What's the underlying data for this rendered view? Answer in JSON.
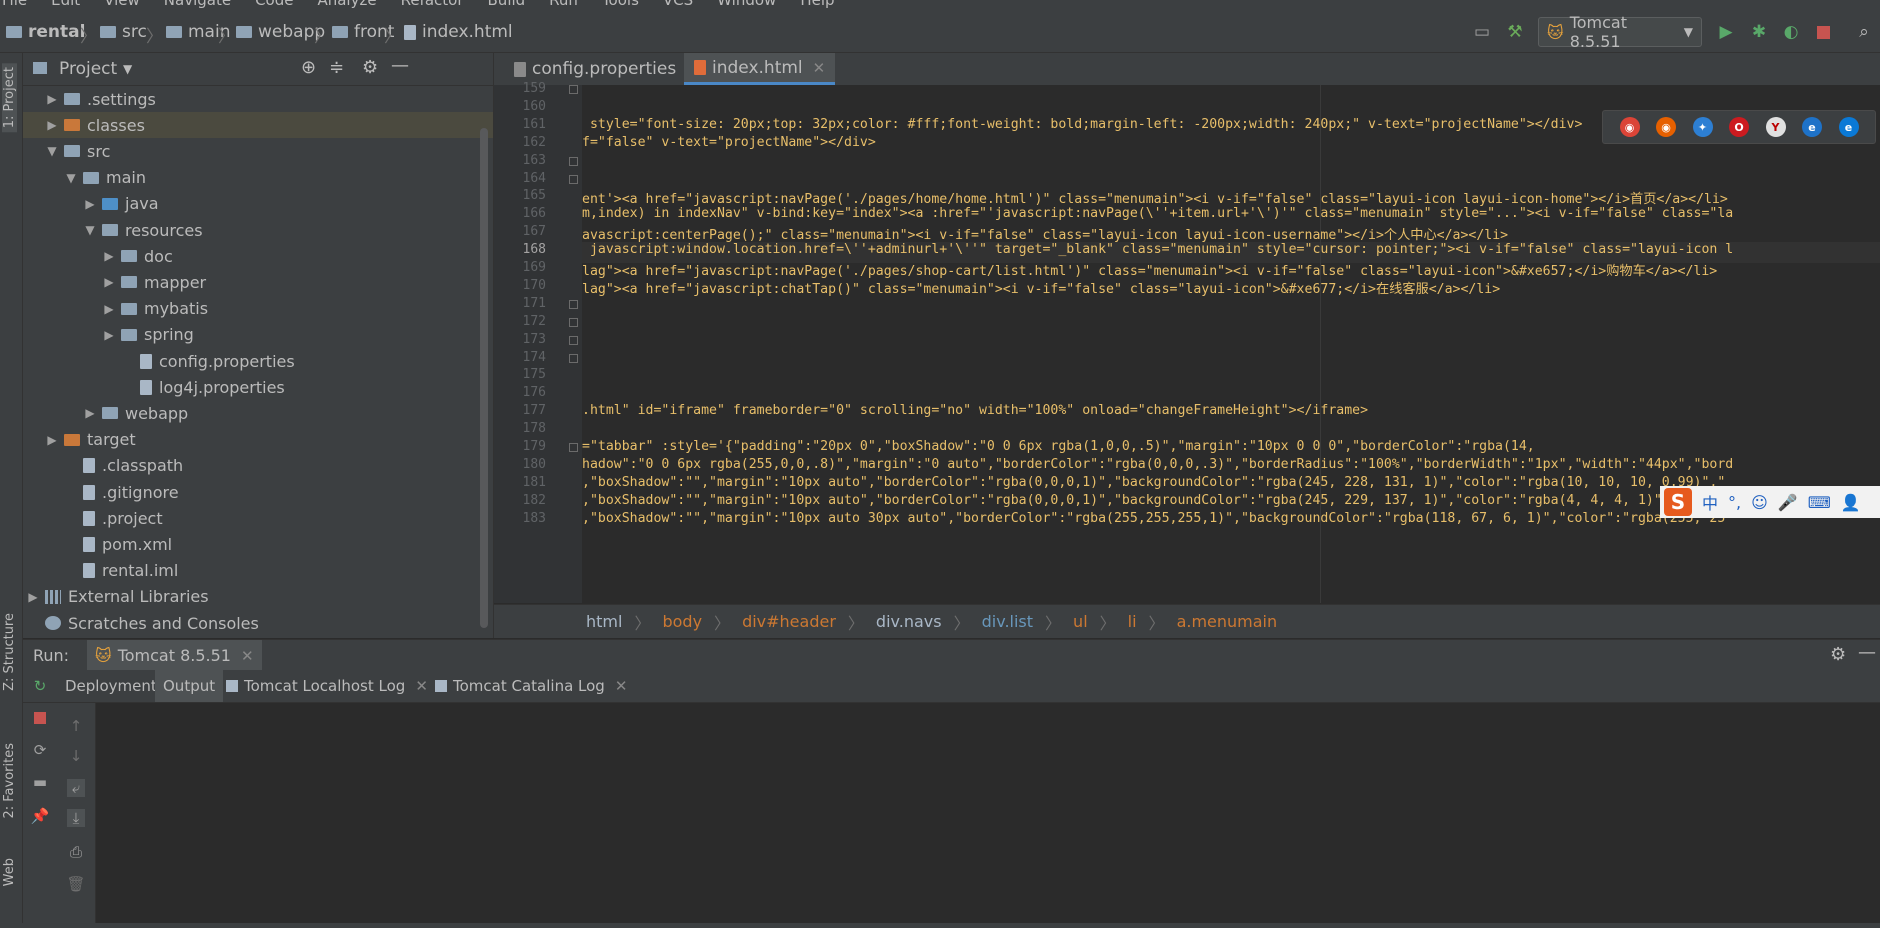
{
  "menu": [
    "File",
    "Edit",
    "View",
    "Navigate",
    "Code",
    "Analyze",
    "Refactor",
    "Build",
    "Run",
    "Tools",
    "VCS",
    "Window",
    "Help"
  ],
  "nav_path": [
    "rental",
    "src",
    "main",
    "webapp",
    "front",
    "index.html"
  ],
  "run_config": "Tomcat 8.5.51",
  "side_tabs": {
    "project": "1: Project",
    "structure": "Z: Structure",
    "favorites": "2: Favorites",
    "web": "Web"
  },
  "project_panel": {
    "title": "Project"
  },
  "tree": [
    {
      "label": ".settings",
      "depth": 1,
      "arrow": "▶",
      "icon": "folder"
    },
    {
      "label": "classes",
      "depth": 1,
      "arrow": "▶",
      "icon": "folder-or"
    },
    {
      "label": "src",
      "depth": 1,
      "arrow": "▼",
      "icon": "folder"
    },
    {
      "label": "main",
      "depth": 2,
      "arrow": "▼",
      "icon": "folder"
    },
    {
      "label": "java",
      "depth": 3,
      "arrow": "▶",
      "icon": "folder-bl"
    },
    {
      "label": "resources",
      "depth": 3,
      "arrow": "▼",
      "icon": "folder"
    },
    {
      "label": "doc",
      "depth": 4,
      "arrow": "▶",
      "icon": "folder"
    },
    {
      "label": "mapper",
      "depth": 4,
      "arrow": "▶",
      "icon": "folder"
    },
    {
      "label": "mybatis",
      "depth": 4,
      "arrow": "▶",
      "icon": "folder"
    },
    {
      "label": "spring",
      "depth": 4,
      "arrow": "▶",
      "icon": "folder"
    },
    {
      "label": "config.properties",
      "depth": 5,
      "arrow": "",
      "icon": "file"
    },
    {
      "label": "log4j.properties",
      "depth": 5,
      "arrow": "",
      "icon": "file"
    },
    {
      "label": "webapp",
      "depth": 3,
      "arrow": "▶",
      "icon": "folder"
    },
    {
      "label": "target",
      "depth": 1,
      "arrow": "▶",
      "icon": "folder-or"
    },
    {
      "label": ".classpath",
      "depth": 2,
      "arrow": "",
      "icon": "file"
    },
    {
      "label": ".gitignore",
      "depth": 2,
      "arrow": "",
      "icon": "file"
    },
    {
      "label": ".project",
      "depth": 2,
      "arrow": "",
      "icon": "file"
    },
    {
      "label": "pom.xml",
      "depth": 2,
      "arrow": "",
      "icon": "file"
    },
    {
      "label": "rental.iml",
      "depth": 2,
      "arrow": "",
      "icon": "file"
    },
    {
      "label": "External Libraries",
      "depth": 0,
      "arrow": "▶",
      "icon": "lib"
    },
    {
      "label": "Scratches and Consoles",
      "depth": 0,
      "arrow": "",
      "icon": "scratch"
    }
  ],
  "editor_tabs": [
    {
      "label": "config.properties",
      "active": false
    },
    {
      "label": "index.html",
      "active": true
    }
  ],
  "code_lines": [
    {
      "n": "159",
      "t": ""
    },
    {
      "n": "160",
      "t": ""
    },
    {
      "n": "161",
      "t": " style=\"font-size: 20px;top: 32px;color: #fff;font-weight: bold;margin-left: -200px;width: 240px;\" v-text=\"projectName\"></div>"
    },
    {
      "n": "162",
      "t": "f=\"false\" v-text=\"projectName\"></div>"
    },
    {
      "n": "163",
      "t": ""
    },
    {
      "n": "164",
      "t": ""
    },
    {
      "n": "165",
      "t": "ent'><a href=\"javascript:navPage('./pages/home/home.html')\" class=\"menumain\"><i v-if=\"false\" class=\"layui-icon layui-icon-home\"></i>首页</a></li>"
    },
    {
      "n": "166",
      "t": "m,index) in indexNav\" v-bind:key=\"index\"><a :href=\"'javascript:navPage(\\''+item.url+'\\')'\" class=\"menumain\" style=\"...\"><i v-if=\"false\" class=\"la"
    },
    {
      "n": "167",
      "t": "avascript:centerPage();\" class=\"menumain\"><i v-if=\"false\" class=\"layui-icon layui-icon-username\"></i>个人中心</a></li>"
    },
    {
      "n": "168",
      "t": " javascript:window.location.href=\\''+adminurl+'\\''\" target=\"_blank\" class=\"menumain\" style=\"cursor: pointer;\"><i v-if=\"false\" class=\"layui-icon l"
    },
    {
      "n": "169",
      "t": "lag\"><a href=\"javascript:navPage('./pages/shop-cart/list.html')\" class=\"menumain\"><i v-if=\"false\" class=\"layui-icon\">&#xe657;</i>购物车</a></li>"
    },
    {
      "n": "170",
      "t": "lag\"><a href=\"javascript:chatTap()\" class=\"menumain\"><i v-if=\"false\" class=\"layui-icon\">&#xe677;</i>在线客服</a></li>"
    },
    {
      "n": "171",
      "t": ""
    },
    {
      "n": "172",
      "t": ""
    },
    {
      "n": "173",
      "t": ""
    },
    {
      "n": "174",
      "t": ""
    },
    {
      "n": "175",
      "t": ""
    },
    {
      "n": "176",
      "t": ""
    },
    {
      "n": "177",
      "t": ".html\" id=\"iframe\" frameborder=\"0\" scrolling=\"no\" width=\"100%\" onload=\"changeFrameHeight\"></iframe>"
    },
    {
      "n": "178",
      "t": ""
    },
    {
      "n": "179",
      "t": "=\"tabbar\" :style='{\"padding\":\"20px 0\",\"boxShadow\":\"0 0 6px rgba(1,0,0,.5)\",\"margin\":\"10px 0 0 0\",\"borderColor\":\"rgba(14,"
    },
    {
      "n": "180",
      "t": "hadow\":\"0 0 6px rgba(255,0,0,.8)\",\"margin\":\"0 auto\",\"borderColor\":\"rgba(0,0,0,.3)\",\"borderRadius\":\"100%\",\"borderWidth\":\"1px\",\"width\":\"44px\",\"bord"
    },
    {
      "n": "181",
      "t": ",\"boxShadow\":\"\",\"margin\":\"10px auto\",\"borderColor\":\"rgba(0,0,0,1)\",\"backgroundColor\":\"rgba(245, 228, 131, 1)\",\"color\":\"rgba(10, 10, 10, 0.99)\",\""
    },
    {
      "n": "182",
      "t": ",\"boxShadow\":\"\",\"margin\":\"10px auto\",\"borderColor\":\"rgba(0,0,0,1)\",\"backgroundColor\":\"rgba(245, 229, 137, 1)\",\"color\":\"rgba(4, 4, 4, 1)\",\"textAli"
    },
    {
      "n": "183",
      "t": ",\"boxShadow\":\"\",\"margin\":\"10px auto 30px auto\",\"borderColor\":\"rgba(255,255,255,1)\",\"backgroundColor\":\"rgba(118, 67, 6, 1)\",\"color\":\"rgba(255, 25"
    }
  ],
  "breadcrumb": [
    {
      "label": "html",
      "color": "#a9b7c6"
    },
    {
      "label": "body",
      "color": "#cc7832"
    },
    {
      "label": "div#header",
      "color": "#cc7832"
    },
    {
      "label": "div.navs",
      "color": "#a9b7c6"
    },
    {
      "label": "div.list",
      "color": "#6897bb"
    },
    {
      "label": "ul",
      "color": "#cc7832"
    },
    {
      "label": "li",
      "color": "#cc7832"
    },
    {
      "label": "a.menumain",
      "color": "#cc7832"
    }
  ],
  "run": {
    "label": "Run:",
    "tab": "Tomcat 8.5.51",
    "subtabs": [
      "Deployment",
      "Output",
      "Tomcat Localhost Log",
      "Tomcat Catalina Log"
    ]
  },
  "ime": {
    "lang": "中",
    "punct": "°,"
  },
  "colors": {
    "bg": "#2b2b2b",
    "panel": "#3c3f41",
    "accent": "#4a88c7",
    "tag": "#e8bf6a",
    "string": "#6a8759"
  }
}
